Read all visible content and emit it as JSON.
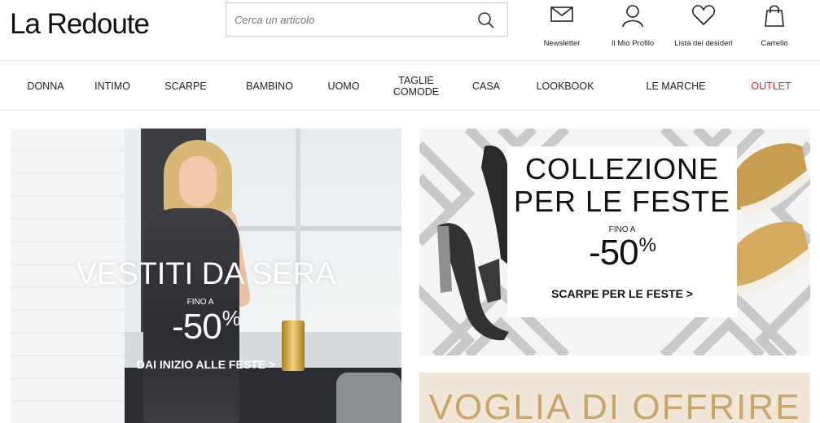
{
  "header": {
    "logo": "La Redoute",
    "search_placeholder": "Cerca un articolo",
    "icons": {
      "newsletter": "Newsletter",
      "profile": "Il Mio Profilo",
      "wishlist": "Lista dei desideri",
      "cart": "Carrello"
    }
  },
  "nav": {
    "items": [
      "DONNA",
      "INTIMO",
      "SCARPE",
      "BAMBINO",
      "UOMO",
      "TAGLIE COMODE",
      "CASA",
      "LOOKBOOK",
      "LE MARCHE",
      "OUTLET"
    ],
    "outlet_color": "#e0262d"
  },
  "hero_left": {
    "title": "VESTITI DA SERA",
    "fino": "FINO A",
    "percent": "-50",
    "percent_sign": "%",
    "cta": "DAI INIZIO ALLE FESTE >"
  },
  "hero_right_top": {
    "title_line1": "COLLEZIONE",
    "title_line2": "PER LE FESTE",
    "fino": "FINO A",
    "percent": "-50",
    "percent_sign": "%",
    "cta": "SCARPE PER LE FESTE >"
  },
  "hero_right_bottom": {
    "title": "VOGLIA DI OFFRIRE",
    "title_color": "#c6a66a"
  }
}
